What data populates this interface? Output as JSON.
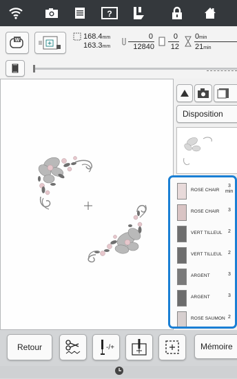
{
  "status_bar": {
    "icons": [
      "wifi-icon",
      "camera-icon",
      "document-icon",
      "help-icon",
      "presser-foot-icon",
      "lock-icon",
      "home-icon"
    ]
  },
  "info": {
    "width": "168.4",
    "height": "163.3",
    "unit": "mm",
    "stitch_current": "0",
    "stitch_total": "12840",
    "color_current": "0",
    "color_total": "12",
    "time_current": "0",
    "time_total": "21",
    "time_unit": "min"
  },
  "right_panel": {
    "layout_label": "Disposition"
  },
  "threads": [
    {
      "name": "ROSE CHAIR",
      "num": "3",
      "color": "#e8dada",
      "selected": true
    },
    {
      "name": "ROSE CHAIR",
      "num": "3",
      "color": "#d9c4c4"
    },
    {
      "name": "VERT TILLEUL",
      "num": "2",
      "color": "#6e6e6e"
    },
    {
      "name": "VERT TILLEUL",
      "num": "2",
      "color": "#6e6e6e"
    },
    {
      "name": "ARGENT",
      "num": "3",
      "color": "#7a7a7a"
    },
    {
      "name": "ARGENT",
      "num": "3",
      "color": "#6c6c6c"
    },
    {
      "name": "ROSE SAUMON",
      "num": "2",
      "color": "#d7cfcf"
    }
  ],
  "first_thread_time_label": "min",
  "bottom": {
    "back_label": "Retour",
    "memory_label": "Mémoire"
  },
  "colors": {
    "highlight": "#1a7fd4",
    "top_bar": "#34383c"
  }
}
